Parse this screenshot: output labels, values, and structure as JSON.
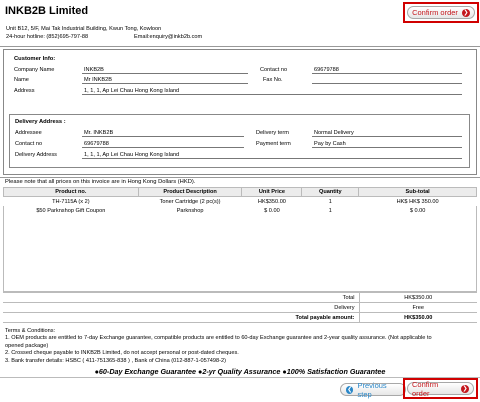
{
  "company": {
    "name": "INKB2B Limited",
    "address": "Unit B12, 5/F, Mai Tak Industrial Building, Kwun Tong, Kowloon",
    "hotline": "24-hour hotline: (852)695-797-88",
    "email": "Email:enquiry@inkb2b.com"
  },
  "buttons": {
    "confirm": "Confirm order",
    "previous": "Previous step"
  },
  "customer": {
    "title": "Customer Info:",
    "company_label": "Company Name",
    "company_value": "INKB2B",
    "name_label": "Name",
    "name_value": "Mr INKB2B",
    "address_label": "Address",
    "address_value": "1, 1, 1, Ap Lei Chau Hong Kong Island",
    "contact_label": "Contact no",
    "contact_value": "69679788",
    "fax_label": "Fax No."
  },
  "delivery": {
    "title": "Delivery Address :",
    "addressee_label": "Addressee",
    "addressee_value": "Mr. INKB2B",
    "contact_label": "Contact no",
    "contact_value": "69679788",
    "address_label": "Delivery Address",
    "address_value": "1, 1, 1, Ap Lei Chau Hong Kong Island",
    "term_label": "Delivery term",
    "term_value": "Normal Delivery",
    "payment_label": "Payment term",
    "payment_value": "Pay by Cash"
  },
  "note": "Please note that all prices on this invoice are in Hong Kong Dollars (HKD).",
  "table": {
    "headers": [
      "Product no.",
      "Product Description",
      "Unit Price",
      "Quantity",
      "Sub-total"
    ],
    "rows": [
      [
        "TH-7115A (x 2)",
        "Toner Cartridge  (2 pc(s))",
        "HK$350.00",
        "1",
        "HK$ HK$ 350.00"
      ],
      [
        "$50 Parknshop Gift Coupon",
        "Parknshop",
        "$ 0.00",
        "1",
        "$ 0.00"
      ]
    ]
  },
  "totals": {
    "total_label": "Total",
    "total_value": "HK$350.00",
    "delivery_label": "Delivery",
    "delivery_value": "Free",
    "payable_label": "Total payable amount:",
    "payable_value": "HK$350.00"
  },
  "terms": {
    "title": "Terms & Conditions:",
    "t1": "1. OEM products are entitled to 7-day Exchange guarantee, compatible products are entitled to 60-day Exchange guarantee and 2-year quality assurance. (Not applicable to",
    "t1b": "opened package)",
    "t2": "2. Crossed cheque payable to INKB2B Limited, do not accept personal or post-dated cheques.",
    "t3": "3. Bank transfer details: HSBC ( 411-751365-838 ) , Bank of China (012-887-1-057498-2)",
    "guarantee": "●60-Day Exchange Guarantee ●2-yr Quality Assurance ●100% Satisfaction Guarantee"
  },
  "colors": {
    "accent": "#c4171d",
    "blue": "#2a87c8",
    "highlight": "#d00000"
  },
  "icons": {
    "confirm": "arrow-right-circle-icon",
    "previous": "arrow-left-circle-icon"
  }
}
